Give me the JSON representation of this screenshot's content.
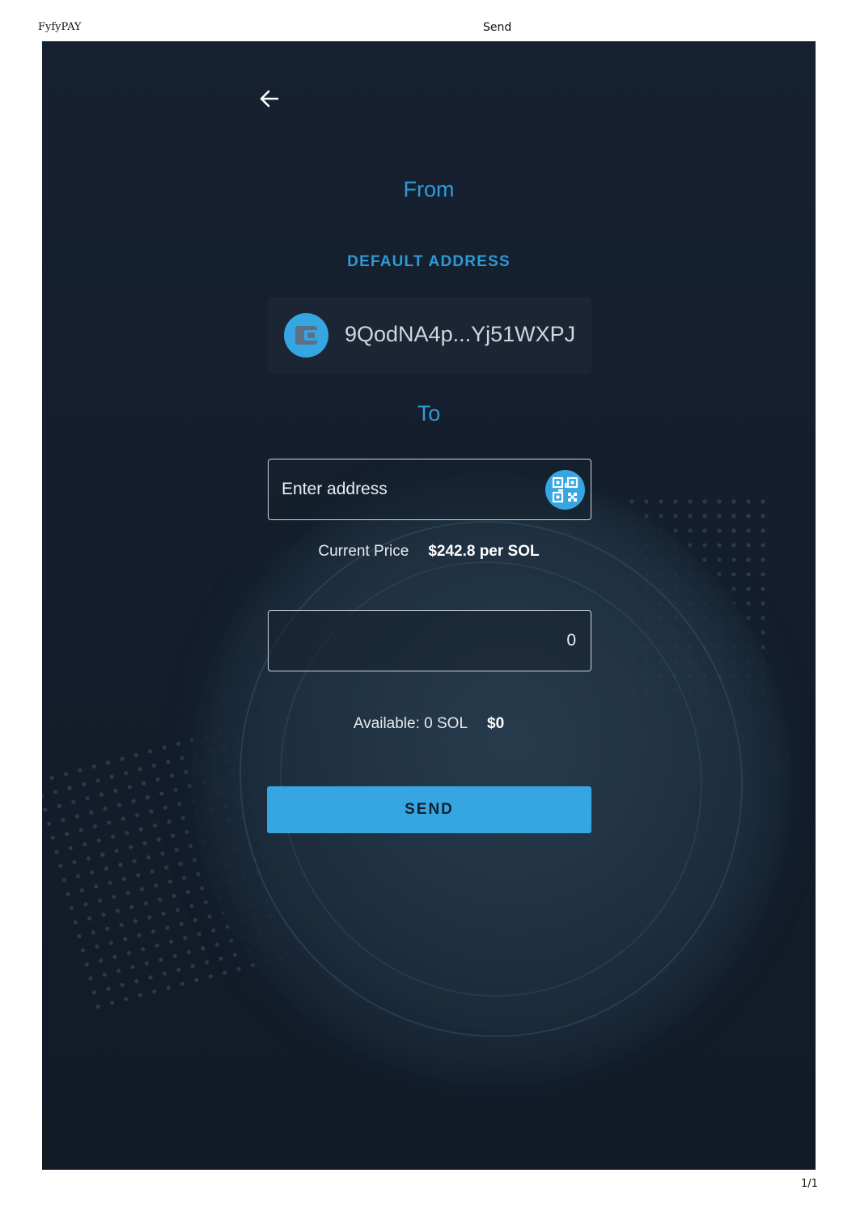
{
  "print_header": {
    "site_name": "FyfyPAY",
    "page_title": "Send"
  },
  "print_footer": {
    "page_count": "1/1"
  },
  "from_section": {
    "heading": "From",
    "default_address_label": "DEFAULT ADDRESS",
    "address": "9QodNA4p...Yj51WXPJ"
  },
  "to_section": {
    "heading": "To",
    "address_placeholder": "Enter address"
  },
  "price": {
    "label": "Current Price",
    "value": "$242.8 per SOL"
  },
  "amount": {
    "value": "0"
  },
  "balance": {
    "label": "Available: 0 SOL",
    "usd_value": "$0"
  },
  "send_button_label": "SEND",
  "colors": {
    "accent": "#36a6e3",
    "heading": "#2f9ad6",
    "background": "#162131"
  },
  "icons": {
    "back": "arrow-left-icon",
    "wallet": "wallet-icon",
    "scan": "qr-code-icon"
  }
}
